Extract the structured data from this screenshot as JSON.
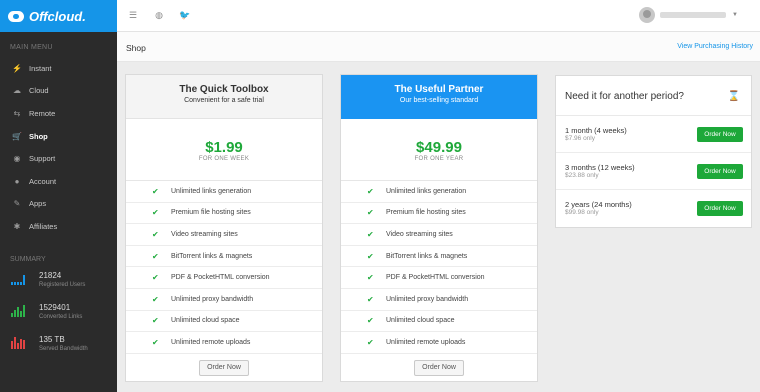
{
  "brand": {
    "name": "Offcloud."
  },
  "sidebar": {
    "menu_title": "MAIN MENU",
    "items": [
      {
        "label": "Instant",
        "icon": "lightning-icon"
      },
      {
        "label": "Cloud",
        "icon": "cloud-icon"
      },
      {
        "label": "Remote",
        "icon": "remote-icon"
      },
      {
        "label": "Shop",
        "icon": "cart-icon",
        "active": true
      },
      {
        "label": "Support",
        "icon": "support-icon"
      },
      {
        "label": "Account",
        "icon": "account-icon"
      },
      {
        "label": "Apps",
        "icon": "apps-icon"
      },
      {
        "label": "Affiliates",
        "icon": "affiliates-icon"
      }
    ],
    "summary_title": "SUMMARY",
    "stats": [
      {
        "value": "21824",
        "label": "Registered Users",
        "color": "#1595e8"
      },
      {
        "value": "1529401",
        "label": "Converted Links",
        "color": "#2db34a"
      },
      {
        "value": "135 TB",
        "label": "Served Bandwidth",
        "color": "#e24343"
      }
    ]
  },
  "topbar": {
    "icons": [
      "menu-icon",
      "globe-icon",
      "twitter-icon"
    ]
  },
  "page": {
    "title": "Shop",
    "history_link": "View Purchasing History"
  },
  "plans": [
    {
      "name": "The Quick Toolbox",
      "subtitle": "Convenient for a safe trial",
      "price": "$1.99",
      "period": "FOR ONE WEEK",
      "features": [
        "Unlimited links generation",
        "Premium file hosting sites",
        "Video streaming sites",
        "BitTorrent links & magnets",
        "PDF & PocketHTML conversion",
        "Unlimited proxy bandwidth",
        "Unlimited cloud space",
        "Unlimited remote uploads"
      ],
      "button": "Order Now"
    },
    {
      "name": "The Useful Partner",
      "subtitle": "Our best-selling standard",
      "price": "$49.99",
      "period": "FOR ONE YEAR",
      "features": [
        "Unlimited links generation",
        "Premium file hosting sites",
        "Video streaming sites",
        "BitTorrent links & magnets",
        "PDF & PocketHTML conversion",
        "Unlimited proxy bandwidth",
        "Unlimited cloud space",
        "Unlimited remote uploads"
      ],
      "button": "Order Now"
    }
  ],
  "periods": {
    "title": "Need it for another period?",
    "options": [
      {
        "name": "1 month (4 weeks)",
        "price": "$7.96 only",
        "button": "Order Now"
      },
      {
        "name": "3 months (12 weeks)",
        "price": "$23.88 only",
        "button": "Order Now"
      },
      {
        "name": "2 years (24 months)",
        "price": "$99.98 only",
        "button": "Order Now"
      }
    ]
  },
  "colors": {
    "accent": "#1595e8",
    "green": "#1da839",
    "sidebar": "#2b2b2b"
  }
}
